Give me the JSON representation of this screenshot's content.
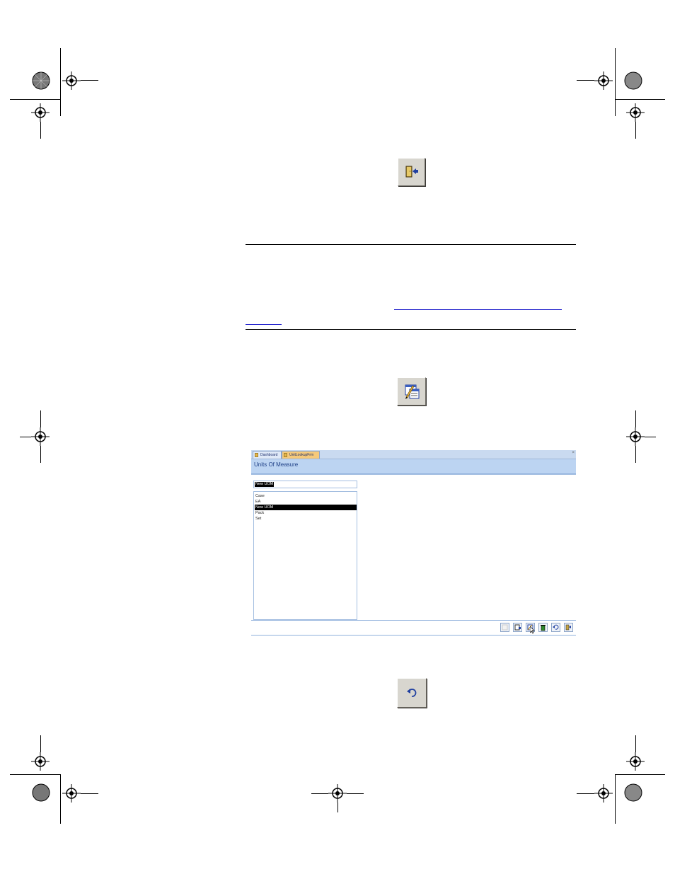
{
  "app_screenshot": {
    "tabs": [
      {
        "label": "Dashboard"
      },
      {
        "label": "UnitLookupFrm"
      }
    ],
    "form_title": "Units Of Measure",
    "uom_field_value": "New UOM",
    "uom_list": [
      "Case",
      "EA",
      "New UOM",
      "Pack",
      "Set"
    ],
    "selected_item": "New UOM"
  },
  "icons": {
    "top": "exit-door-icon",
    "middle": "edit-form-icon",
    "bottom": "undo-icon"
  },
  "colors": {
    "header_bg": "#bcd4f2",
    "tab_active": "#f5c97a",
    "link": "#2222cc"
  }
}
